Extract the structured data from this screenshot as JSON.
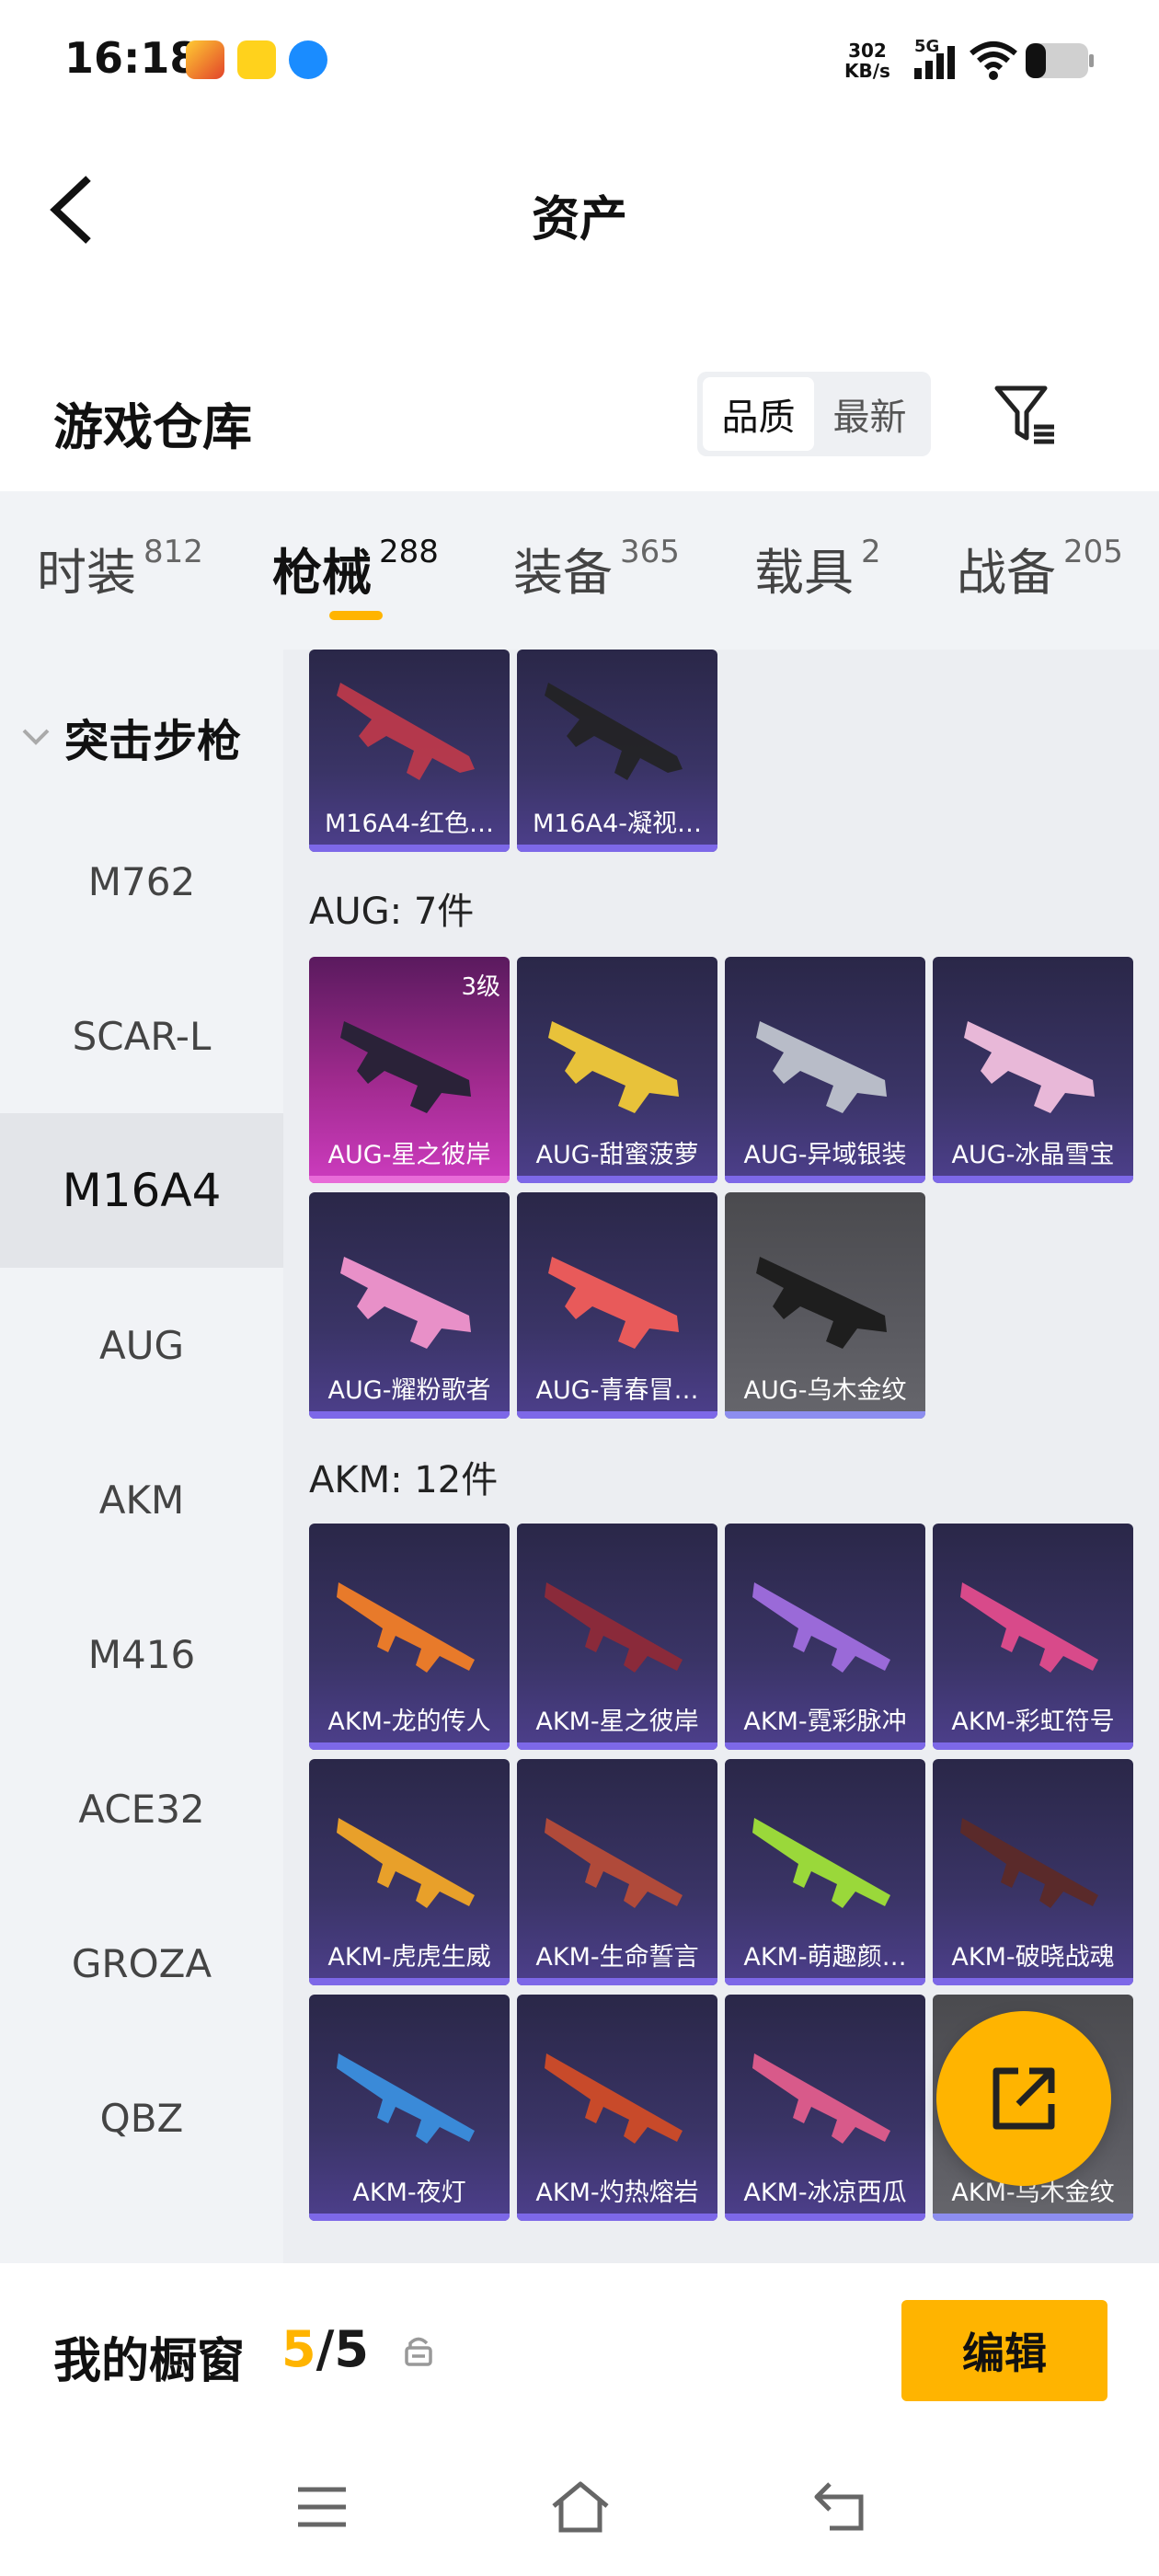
{
  "status": {
    "time": "16:18",
    "speed_value": "302",
    "speed_unit": "KB/s",
    "network": "5G"
  },
  "header": {
    "title": "资产"
  },
  "warehouse": {
    "title": "游戏仓库",
    "sort_quality": "品质",
    "sort_newest": "最新"
  },
  "categories": [
    {
      "label": "时装",
      "count": "812"
    },
    {
      "label": "枪械",
      "count": "288"
    },
    {
      "label": "装备",
      "count": "365"
    },
    {
      "label": "载具",
      "count": "2"
    },
    {
      "label": "战备",
      "count": "205"
    }
  ],
  "sidebar": {
    "group": "突击步枪",
    "items": [
      "M762",
      "SCAR-L",
      "M16A4",
      "AUG",
      "AKM",
      "M416",
      "ACE32",
      "GROZA",
      "QBZ"
    ]
  },
  "sections": {
    "m16a4_items": [
      "M16A4-红色…",
      "M16A4-凝视…"
    ],
    "aug_title": "AUG: 7件",
    "aug_items": [
      "AUG-星之彼岸",
      "AUG-甜蜜菠萝",
      "AUG-异域银装",
      "AUG-冰晶雪宝",
      "AUG-耀粉歌者",
      "AUG-青春冒…",
      "AUG-乌木金纹"
    ],
    "aug_badge": "3级",
    "akm_title": "AKM: 12件",
    "akm_items": [
      "AKM-龙的传人",
      "AKM-星之彼岸",
      "AKM-霓彩脉冲",
      "AKM-彩虹符号",
      "AKM-虎虎生威",
      "AKM-生命誓言",
      "AKM-萌趣颜…",
      "AKM-破晓战魂",
      "AKM-夜灯",
      "AKM-灼热熔岩",
      "AKM-冰凉西瓜",
      "AKM-乌木金纹"
    ]
  },
  "showcase": {
    "label": "我的橱窗",
    "count_current": "5",
    "count_sep": "/",
    "count_total": "5",
    "edit_label": "编辑"
  },
  "colors": {
    "accent": "#ffb400",
    "card_border": "#7d68e8"
  }
}
